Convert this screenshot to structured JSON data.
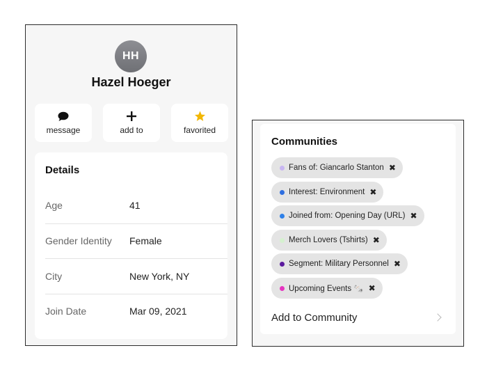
{
  "profile": {
    "initials": "HH",
    "name": "Hazel Hoeger"
  },
  "actions": [
    {
      "label": "message",
      "icon": "chat-bubble-icon"
    },
    {
      "label": "add to",
      "icon": "plus-icon"
    },
    {
      "label": "favorited",
      "icon": "star-icon",
      "color": "#f2b705"
    }
  ],
  "details": {
    "title": "Details",
    "rows": [
      {
        "label": "Age",
        "value": "41"
      },
      {
        "label": "Gender Identity",
        "value": "Female"
      },
      {
        "label": "City",
        "value": "New York, NY"
      },
      {
        "label": "Join Date",
        "value": "Mar 09, 2021"
      }
    ]
  },
  "communities": {
    "title": "Communities",
    "chips": [
      {
        "label": "Fans of: Giancarlo Stanton",
        "color": "#c8b6f2"
      },
      {
        "label": "Interest: Environment",
        "color": "#2f6fe0"
      },
      {
        "label": "Joined from: Opening Day (URL)",
        "color": "#2f80e8"
      },
      {
        "label": "Merch Lovers (Tshirts)",
        "color": "#d5f1cf"
      },
      {
        "label": "Segment: Military Personnel",
        "color": "#5b1a9e"
      },
      {
        "label": "Upcoming Events 🗞️",
        "color": "#e535c0"
      }
    ],
    "add_label": "Add to Community"
  }
}
